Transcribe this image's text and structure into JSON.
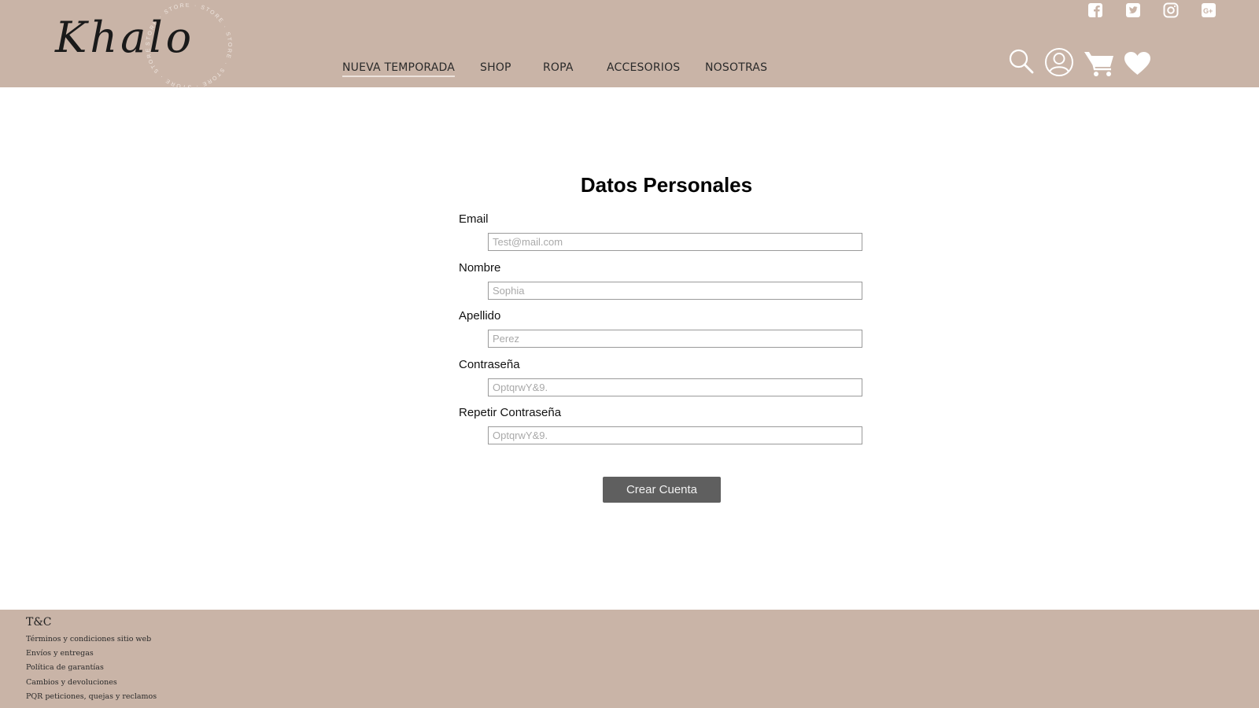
{
  "brand": {
    "logo_text": "Khalo",
    "ring_text": "STORE"
  },
  "nav": {
    "items": [
      {
        "label": "NUEVA TEMPORADA",
        "active": true
      },
      {
        "label": "SHOP"
      },
      {
        "label": "ROPA"
      },
      {
        "label": "ACCESORIOS"
      },
      {
        "label": "NOSOTRAS"
      }
    ]
  },
  "social_icons": [
    "facebook-icon",
    "twitter-icon",
    "instagram-icon",
    "google-plus-icon"
  ],
  "tool_icons": [
    "search-icon",
    "user-icon",
    "cart-icon",
    "heart-icon"
  ],
  "form": {
    "title": "Datos Personales",
    "fields": [
      {
        "label": "Email",
        "placeholder": "Test@mail.com"
      },
      {
        "label": "Nombre",
        "placeholder": "Sophia"
      },
      {
        "label": "Apellido",
        "placeholder": "Perez"
      },
      {
        "label": "Contraseña",
        "placeholder": "OptqrwY&9."
      },
      {
        "label": "Repetir Contraseña",
        "placeholder": "OptqrwY&9."
      }
    ],
    "submit_label": "Crear Cuenta"
  },
  "footer": {
    "title": "T&C",
    "links": [
      "Términos y condiciones sitio web",
      "Envíos y entregas",
      "Política de garantías",
      "Cambios y devoluciones",
      "PQR peticiones, quejas y reclamos"
    ]
  },
  "colors": {
    "header_bg": "#c9b4a7",
    "button_bg": "#5f5f5f",
    "icon_white": "#ffffff"
  }
}
